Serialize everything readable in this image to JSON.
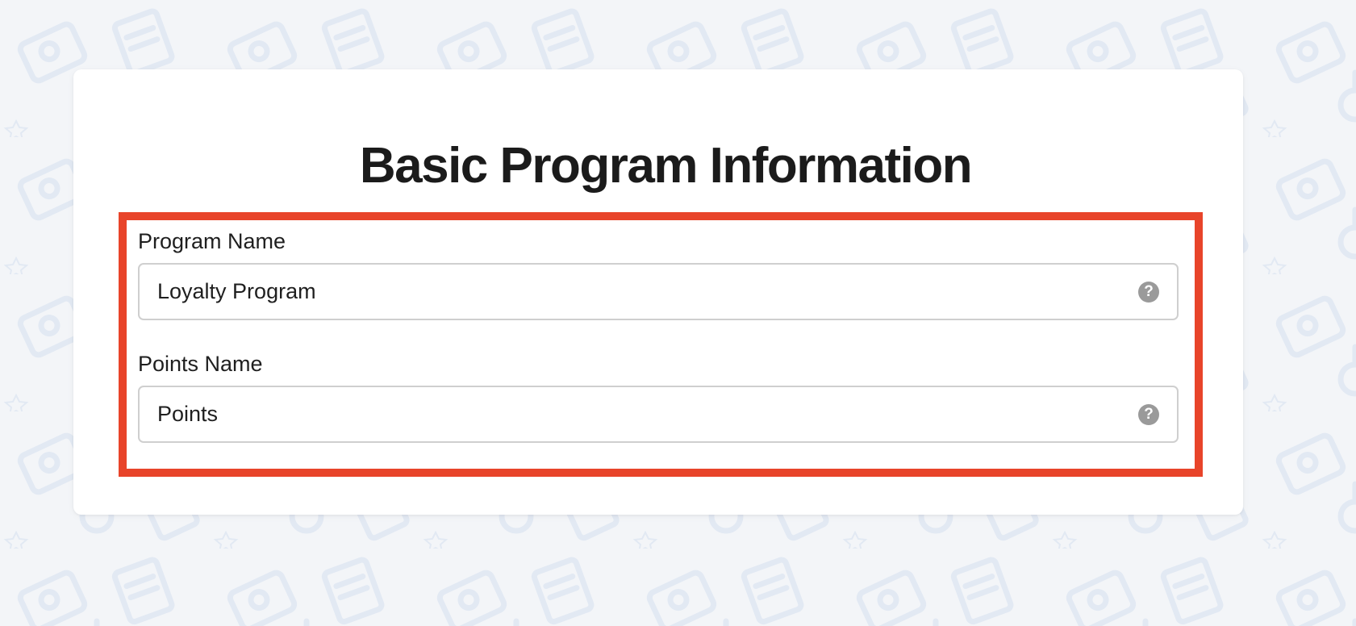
{
  "page": {
    "title": "Basic Program Information"
  },
  "fields": {
    "program_name": {
      "label": "Program Name",
      "value": "Loyalty Program",
      "help_icon": "question-circle-icon",
      "help_glyph": "?"
    },
    "points_name": {
      "label": "Points Name",
      "value": "Points",
      "help_icon": "question-circle-icon",
      "help_glyph": "?"
    }
  },
  "colors": {
    "background": "#f3f5f8",
    "card": "#ffffff",
    "highlight_border": "#e8442a",
    "help_icon": "#9a9a9a",
    "text": "#1b1b1b"
  }
}
